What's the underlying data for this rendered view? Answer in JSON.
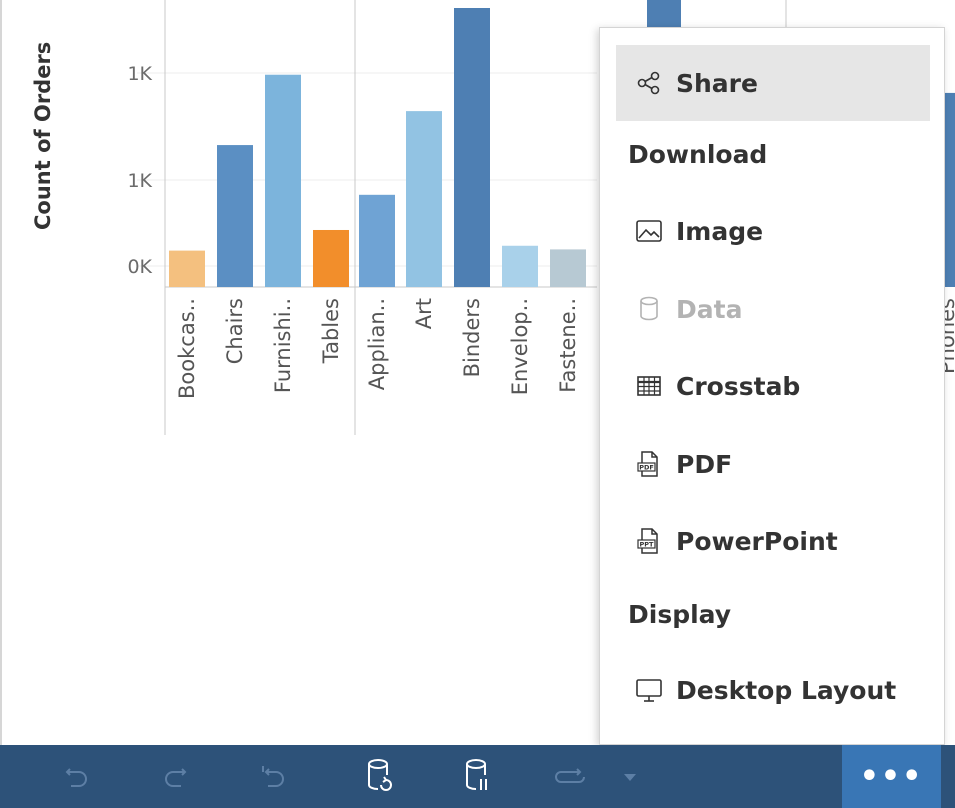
{
  "chart_data": {
    "type": "bar",
    "ylabel": "Count of Orders",
    "y_ticks": [
      "1K",
      "1K",
      "0K"
    ],
    "categories": [
      "Bookcas..",
      "Chairs",
      "Furnishi..",
      "Tables",
      "Applian..",
      "Art",
      "Binders",
      "Envelop..",
      "Fastene..",
      "Phones"
    ],
    "values": [
      300,
      1170,
      1750,
      470,
      760,
      1450,
      2300,
      340,
      310,
      1600
    ],
    "ylim": [
      0,
      2300
    ],
    "colors": [
      "#f4c07f",
      "#5b8fc3",
      "#7cb4dc",
      "#f28e2b",
      "#6fa3d4",
      "#92c3e3",
      "#4e7fb3",
      "#a9d1ea",
      "#b7c9d3",
      "#4e7fb3"
    ],
    "grid": true
  },
  "menu": {
    "share_label": "Share",
    "download_header": "Download",
    "image_label": "Image",
    "data_label": "Data",
    "crosstab_label": "Crosstab",
    "pdf_label": "PDF",
    "powerpoint_label": "PowerPoint",
    "display_header": "Display",
    "desktop_layout_label": "Desktop Layout",
    "pdf_badge": "PDF",
    "ppt_badge": "PPT"
  },
  "toolbar": {
    "more_label": "•••",
    "icons": [
      "undo-icon",
      "redo-icon",
      "revert-icon",
      "refresh-data-icon",
      "pause-updates-icon",
      "replay-icon",
      "dropdown-arrow-icon"
    ]
  }
}
